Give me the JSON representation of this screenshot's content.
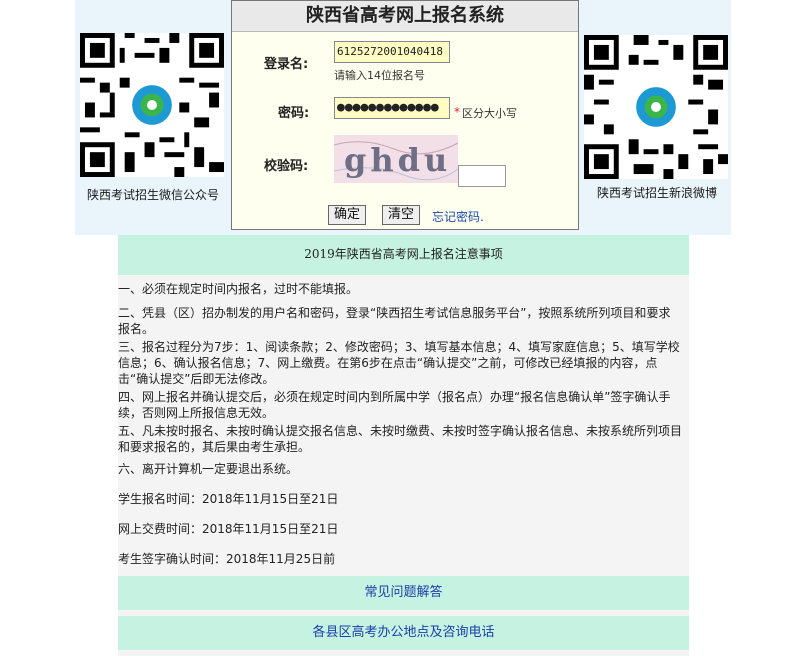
{
  "login": {
    "title": "陕西省高考网上报名系统",
    "username_label": "登录名:",
    "username_value": "6125272001040418",
    "username_hint": "请输入14位报名号",
    "password_label": "密码:",
    "password_value": "●●●●●●●●●●●●●",
    "password_star": "*",
    "password_hint": "区分大小写",
    "captcha_label": "校验码:",
    "captcha_text": "ghdu",
    "confirm_button": "确定",
    "clear_button": "清空",
    "forgot_link": "忘记密码."
  },
  "qr_codes": {
    "left_caption": "陕西考试招生微信公众号",
    "right_caption": "陕西考试招生新浪微博"
  },
  "notice": {
    "title": "2019年陕西省高考网上报名注意事项",
    "items": [
      "一、必须在规定时间内报名，过时不能填报。",
      "二、凭县（区）招办制发的用户名和密码，登录“陕西招生考试信息服务平台”，按照系统所列项目和要求报名。",
      "三、报名过程分为7步：1、阅读条款；2、修改密码；3、填写基本信息；4、填写家庭信息；5、填写学校信息；6、确认报名信息；7、网上缴费。在第6步在点击“确认提交”之前，可修改已经填报的内容，点击“确认提交”后即无法修改。",
      "四、网上报名并确认提交后，必须在规定时间内到所属中学（报名点）办理“报名信息确认单”签字确认手续，否则网上所报信息无效。",
      "五、凡未按时报名、未按时确认提交报名信息、未按时缴费、未按时签字确认报名信息、未按系统所列项目和要求报名的，其后果由考生承担。",
      "六、离开计算机一定要退出系统。",
      "学生报名时间：2018年11月15日至21日",
      "网上交费时间：2018年11月15日至21日",
      "考生签字确认时间：2018年11月25日前"
    ],
    "faq_link": "常见问题解答",
    "offices_link": "各县区高考办公地点及咨询电话"
  },
  "colors": {
    "band": "#eaf4fb",
    "login_bg": "#fffff0",
    "input_bg": "#fffbc4",
    "notice_header": "#c6f2e2",
    "link": "#1b3ea8"
  }
}
